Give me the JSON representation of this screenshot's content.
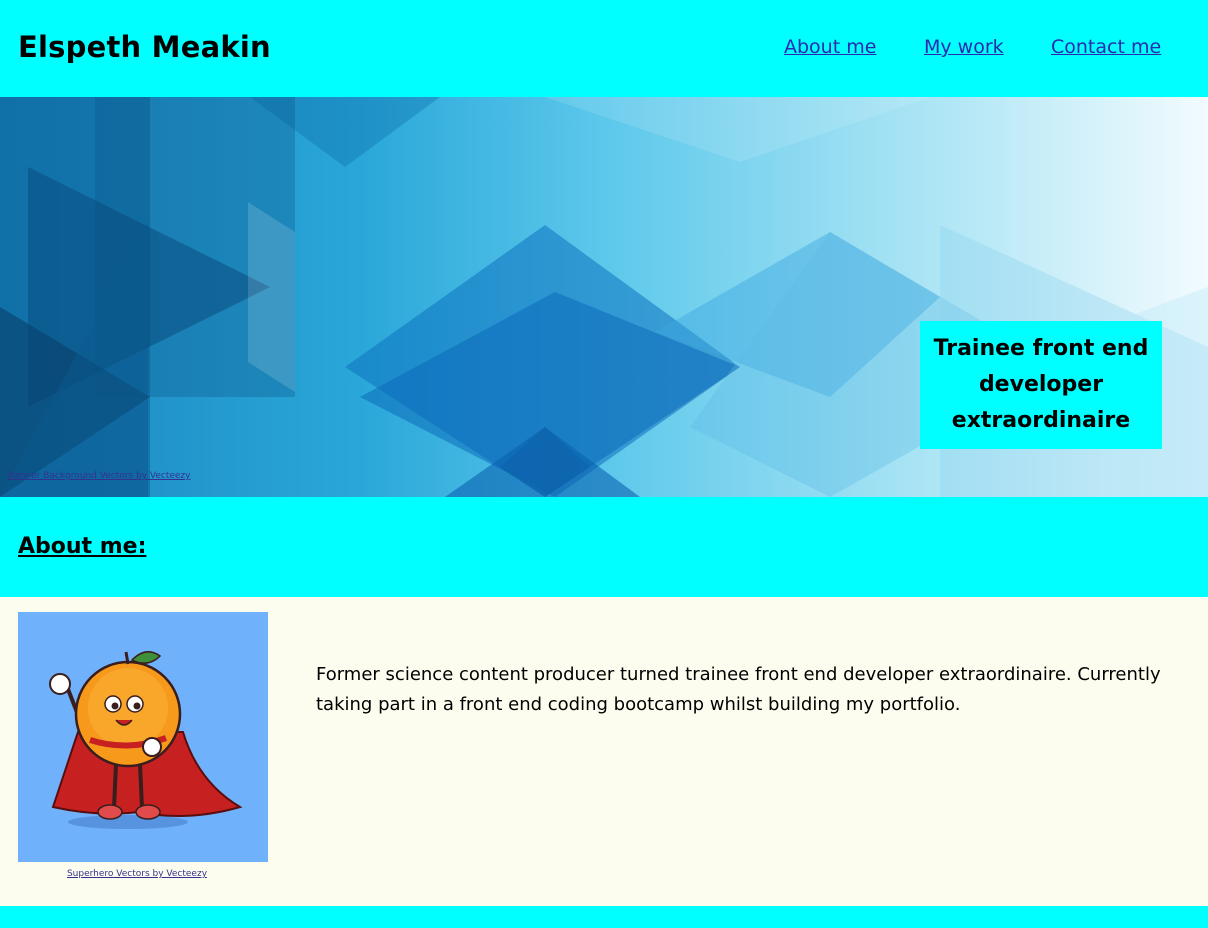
{
  "header": {
    "title": "Elspeth Meakin",
    "nav": [
      "About me",
      "My work",
      "Contact me"
    ]
  },
  "banner": {
    "credit": "Banner Background Vectors by Vecteezy",
    "tagline": "Trainee front end developer extraordinaire"
  },
  "about": {
    "heading": "About me:",
    "bio": "Former science content producer turned trainee front end developer extraordinaire. Currently taking part in a front end coding bootcamp whilst building my portfolio.",
    "image_credit": "Superhero Vectors by Vecteezy"
  },
  "colors": {
    "accent": "#00ffff",
    "link": "#2a2ab0",
    "content_bg": "#fdfdef",
    "avatar_bg": "#6fb1fb"
  }
}
